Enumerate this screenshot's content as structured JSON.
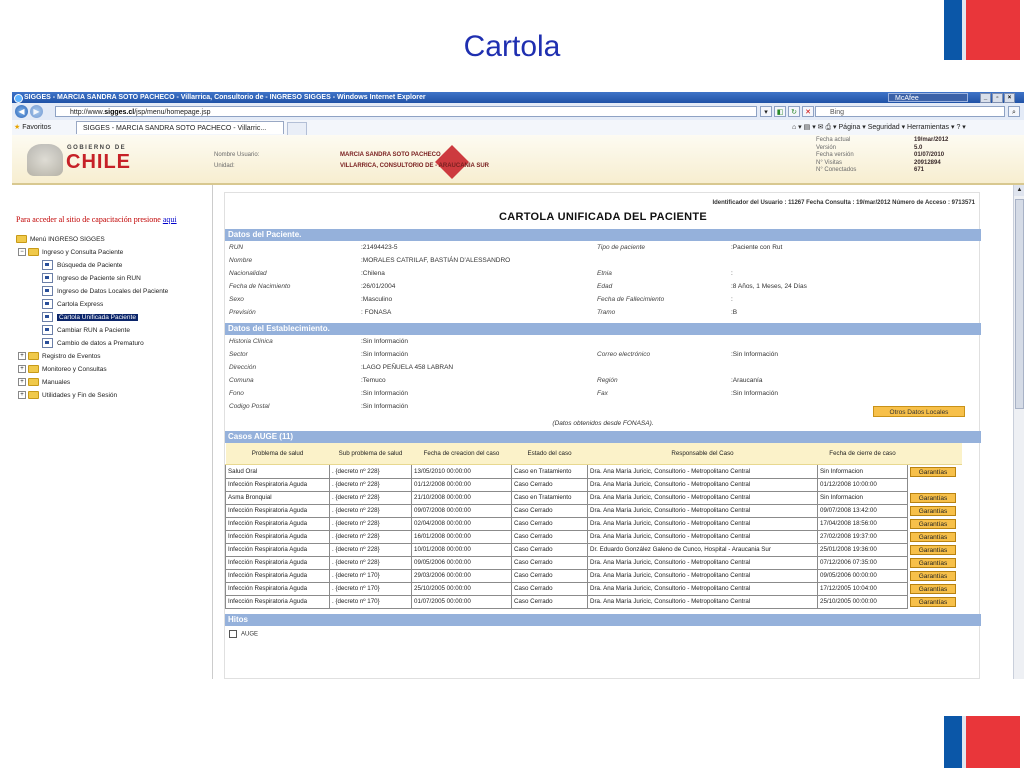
{
  "slide": {
    "title": "Cartola"
  },
  "browser": {
    "window_title": "SIGGES - MARCIA SANDRA SOTO PACHECO - Villarrica, Consultorio de - INGRESO SIGGES - Windows Internet Explorer",
    "mcafee": "McAfee",
    "url_prefix": "http://www.",
    "url_host": "sigges.cl",
    "url_path": "/jsp/menu/homepage.jsp",
    "search_placeholder": "Bing",
    "favorites_label": "Favoritos",
    "tab_label": "SIGGES - MARCIA SANDRA SOTO PACHECO - Villarric...",
    "cmd_pagina": "Página",
    "cmd_seguridad": "Seguridad",
    "cmd_herramientas": "Herramientas"
  },
  "header": {
    "gobierno": "GOBIERNO DE",
    "chile": "CHILE",
    "nombre_label": "Nombre Usuario:",
    "nombre_value": "MARCIA SANDRA SOTO PACHECO",
    "unidad_label": "Unidad:",
    "unidad_value": "VILLARRICA, CONSULTORIO DE - ARAUCANIA SUR",
    "info_labels": [
      "Fecha actual",
      "Versión",
      "Fecha versión",
      "N° Visitas",
      "N° Conectados"
    ],
    "info_values": [
      "19/mar/2012",
      "5.0",
      "01/07/2010",
      "20912894",
      "671"
    ]
  },
  "sidebar": {
    "link_text": "Para acceder al sitio de capacitación presione",
    "link_anchor": "aqui",
    "menu_root": "Menú INGRESO SIGGES",
    "group1": "Ingreso y Consulta Paciente",
    "items": [
      "Búsqueda de Paciente",
      "Ingreso de Paciente sin RUN",
      "Ingreso de Datos Locales del Paciente",
      "Cartola Express",
      "Cartola Unificada Paciente",
      "Cambiar RUN a Paciente",
      "Cambio de datos a Prematuro"
    ],
    "groups": [
      "Registro de Eventos",
      "Monitoreo y Consultas",
      "Manuales",
      "Utilidades y Fin de Sesión"
    ]
  },
  "cartola": {
    "id_line": "Identificador del Usuario : 11267   Fecha Consulta : 19/mar/2012   Número de Acceso : 9713571",
    "title": "CARTOLA UNIFICADA DEL PACIENTE",
    "sec_paciente": "Datos del Paciente.",
    "paciente_rows": [
      {
        "l1": "RUN",
        "v1": ":21494423-5",
        "l2": "Tipo de paciente",
        "v2": ":Paciente con Rut"
      },
      {
        "l1": "Nombre",
        "v1": ":MORALES CATRILAF, BASTIÁN D'ALESSANDRO",
        "l2": "",
        "v2": ""
      },
      {
        "l1": "Nacionalidad",
        "v1": ":Chilena",
        "l2": "Etnia",
        "v2": ":"
      },
      {
        "l1": "Fecha de Nacimiento",
        "v1": ":26/01/2004",
        "l2": "Edad",
        "v2": ":8 Años, 1 Meses, 24 Días"
      },
      {
        "l1": "Sexo",
        "v1": ":Masculino",
        "l2": "Fecha de Fallecimiento",
        "v2": ":"
      },
      {
        "l1": "Previsión",
        "v1": ": FONASA",
        "l2": "Tramo",
        "v2": ":B"
      }
    ],
    "sec_establecimiento": "Datos del Establecimiento.",
    "estab_rows": [
      {
        "l1": "Historia Clínica",
        "v1": ":Sin Información",
        "l2": "",
        "v2": ""
      },
      {
        "l1": "Sector",
        "v1": ":Sin Información",
        "l2": "Correo electrónico",
        "v2": ":Sin Información"
      },
      {
        "l1": "Dirección",
        "v1": ":LAGO PEÑUELA 458 LABRAN",
        "l2": "",
        "v2": ""
      },
      {
        "l1": "Comuna",
        "v1": ":Temuco",
        "l2": "Región",
        "v2": ":Araucanía"
      },
      {
        "l1": "Fono",
        "v1": ":Sin Información",
        "l2": "Fax",
        "v2": ":Sin Información"
      },
      {
        "l1": "Codigo Postal",
        "v1": ":Sin Información",
        "l2": "",
        "v2": ""
      }
    ],
    "otros_label": "Otros Datos Locales",
    "note": "(Datos obtenidos desde FONASA).",
    "sec_auge": "Casos AUGE (11)",
    "auge_headers": [
      "Problema de salud",
      "Sub problema de salud",
      "Fecha de creacion del caso",
      "Estado del caso",
      "Responsable del Caso",
      "Fecha de cierre de caso"
    ],
    "garantias_label": "Garantías",
    "auge_rows": [
      [
        "Salud Oral",
        ". {decreto nº 228}",
        "13/05/2010 00:00:00",
        "Caso en Tratamiento",
        "Dra. Ana María Juricic, Consultorio - Metropolitano Central",
        "Sin Informacion",
        true
      ],
      [
        "Infección Respiratoria Aguda",
        ". {decreto nº 228}",
        "01/12/2008 00:00:00",
        "Caso Cerrado",
        "Dra. Ana María Juricic, Consultorio - Metropolitano Central",
        "01/12/2008 10:00:00",
        false
      ],
      [
        "Asma Bronquial",
        ". {decreto nº 228}",
        "21/10/2008 00:00:00",
        "Caso en Tratamiento",
        "Dra. Ana María Juricic, Consultorio - Metropolitano Central",
        "Sin Informacion",
        true
      ],
      [
        "Infección Respiratoria Aguda",
        ". {decreto nº 228}",
        "09/07/2008 00:00:00",
        "Caso Cerrado",
        "Dra. Ana María Juricic, Consultorio - Metropolitano Central",
        "09/07/2008 13:42:00",
        true
      ],
      [
        "Infección Respiratoria Aguda",
        ". {decreto nº 228}",
        "02/04/2008 00:00:00",
        "Caso Cerrado",
        "Dra. Ana María Juricic, Consultorio - Metropolitano Central",
        "17/04/2008 18:56:00",
        true
      ],
      [
        "Infección Respiratoria Aguda",
        ". {decreto nº 228}",
        "16/01/2008 00:00:00",
        "Caso Cerrado",
        "Dra. Ana María Juricic, Consultorio - Metropolitano Central",
        "27/02/2008 19:37:00",
        true
      ],
      [
        "Infección Respiratoria Aguda",
        ". {decreto nº 228}",
        "10/01/2008 00:00:00",
        "Caso Cerrado",
        "Dr. Eduardo González Galeno de Cunco, Hospital - Araucania Sur",
        "25/01/2008 19:36:00",
        true
      ],
      [
        "Infección Respiratoria Aguda",
        ". {decreto nº 228}",
        "09/05/2006 00:00:00",
        "Caso Cerrado",
        "Dra. Ana María Juricic, Consultorio - Metropolitano Central",
        "07/12/2006 07:35:00",
        true
      ],
      [
        "Infección Respiratoria Aguda",
        ". {decreto nº 170}",
        "29/03/2006 00:00:00",
        "Caso Cerrado",
        "Dra. Ana María Juricic, Consultorio - Metropolitano Central",
        "09/05/2006 00:00:00",
        true
      ],
      [
        "Infección Respiratoria Aguda",
        ". {decreto nº 170}",
        "25/10/2005 00:00:00",
        "Caso Cerrado",
        "Dra. Ana María Juricic, Consultorio - Metropolitano Central",
        "17/12/2005 10:04:00",
        true
      ],
      [
        "Infección Respiratoria Aguda",
        ". {decreto nº 170}",
        "01/07/2005 00:00:00",
        "Caso Cerrado",
        "Dra. Ana María Juricic, Consultorio - Metropolitano Central",
        "25/10/2005 00:00:00",
        true
      ]
    ],
    "sec_hitos": "Hitos",
    "hitos_item": "AUGE"
  },
  "colors": {
    "slide_title": "#1f2fb0",
    "section_bg": "#95b1db",
    "button_bg": "#f7c04a",
    "flag_blue": "#0b57a8",
    "flag_red": "#e9363a"
  },
  "icons": [
    "ie-logo-icon",
    "back-icon",
    "forward-icon",
    "refresh-icon",
    "stop-icon",
    "folder-icon",
    "page-icon",
    "home-icon"
  ]
}
